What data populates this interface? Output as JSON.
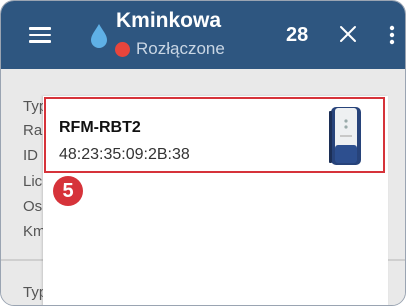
{
  "appbar": {
    "title": "Kminkowa",
    "status": "Rozłączone",
    "count": "28",
    "icons": [
      "menu-icon",
      "water-drop-icon",
      "close-icon",
      "more-vert-icon"
    ],
    "colors": {
      "bar": "#2e5680",
      "status_dot": "#e8453c"
    }
  },
  "background": {
    "labels": [
      "Typ",
      "Ra",
      "ID",
      "Lic",
      "Os",
      "Km",
      "Typ"
    ]
  },
  "dialog": {
    "devices": [
      {
        "name": "RFM-RBT2",
        "mac": "48:23:35:09:2B:38",
        "icon": "bluetooth-device-image"
      }
    ],
    "step_badge": "5",
    "highlight_color": "#d6333a"
  }
}
